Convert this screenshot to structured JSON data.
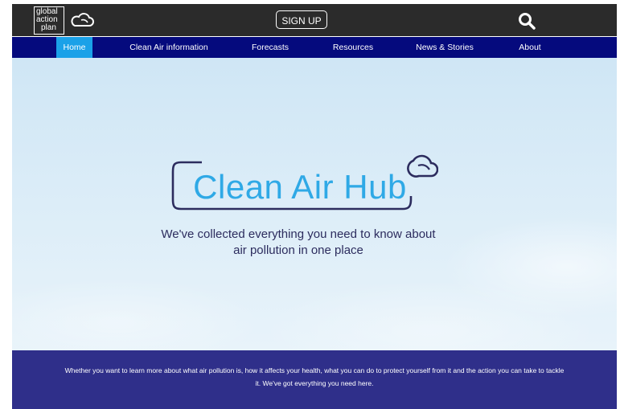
{
  "header": {
    "logo_lines": [
      "global",
      "action",
      "plan"
    ],
    "signup_label": "SIGN UP"
  },
  "nav": {
    "items": [
      {
        "label": "Home",
        "active": true
      },
      {
        "label": "Clean Air information",
        "active": false
      },
      {
        "label": "Forecasts",
        "active": false
      },
      {
        "label": "Resources",
        "active": false
      },
      {
        "label": "News & Stories",
        "active": false
      },
      {
        "label": "About",
        "active": false
      }
    ]
  },
  "hero": {
    "title": "Clean Air Hub",
    "tagline_line1": "We've collected everything you need to know about",
    "tagline_line2": "air pollution in one place"
  },
  "intro": {
    "line1": "Whether you want to learn more about what air pollution is, how it affects your health, what you can do to protect yourself from it and the action you can take to tackle",
    "line2": "it. We've got everything you need here."
  },
  "colors": {
    "topbar": "#2b2b2b",
    "nav": "#050a7d",
    "nav_active": "#1aa1e8",
    "hero_title": "#2fa9e6",
    "band": "#2f2f8a"
  },
  "icons": [
    "cloud-icon",
    "search-icon",
    "cloud-outline-icon"
  ]
}
